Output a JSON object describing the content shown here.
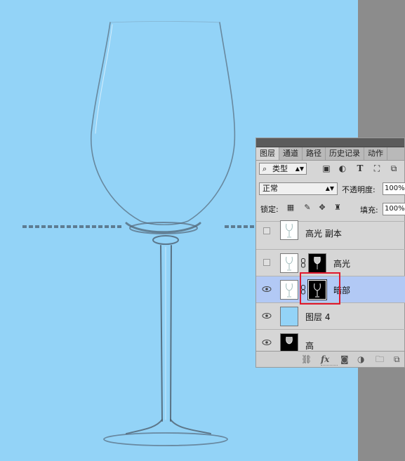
{
  "panel": {
    "tabs": [
      "图层",
      "通道",
      "路径",
      "历史记录",
      "动作"
    ],
    "active_tab": "图层",
    "filter": {
      "label": "类型",
      "icons": [
        "image-filter-icon",
        "adjustment-filter-icon",
        "type-filter-icon",
        "shape-filter-icon",
        "smart-object-filter-icon"
      ]
    },
    "blend_mode": "正常",
    "opacity_label": "不透明度:",
    "opacity_value": "100%",
    "lock_label": "锁定:",
    "fill_label": "填充:",
    "fill_value": "100%",
    "layers": [
      {
        "name": "高光 副本",
        "visible": false,
        "has_mask": false,
        "selected": false
      },
      {
        "name": "高光",
        "visible": false,
        "has_mask": true,
        "selected": false
      },
      {
        "name": "暗部",
        "visible": true,
        "has_mask": true,
        "selected": true
      },
      {
        "name": "图层 4",
        "visible": true,
        "has_mask": false,
        "selected": false
      },
      {
        "name": "高",
        "visible": true,
        "has_mask": false,
        "selected": false
      }
    ],
    "bottom_icons": [
      "link-icon",
      "fx-icon",
      "mask-icon",
      "adjustment-icon",
      "group-folder-icon",
      "new-layer-icon"
    ],
    "fx_label": "fx"
  },
  "colors": {
    "canvas_background": "#93d3f7",
    "pasteboard": "#8c8c8c",
    "selected_layer": "#b2c9f5",
    "highlight": "#e0182d"
  }
}
